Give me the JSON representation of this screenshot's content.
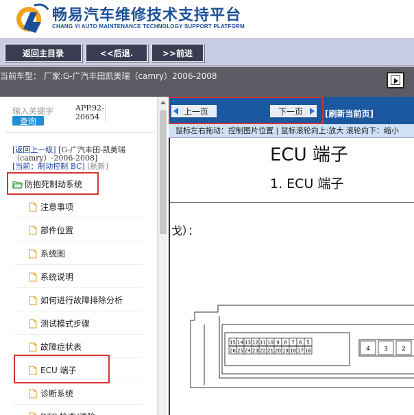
{
  "header": {
    "title": "畅易汽车维修技术支持平台",
    "subtitle": "CHANG YI AUTO MAINTENANCE TECHNOLOGY SUPPORT PLATFORM",
    "brand_color": "#1c4f97"
  },
  "nav": {
    "home_label": "返回主目录",
    "back_label": "<<后退.",
    "forward_label": ">>前进"
  },
  "car_bar": {
    "text": "当前车型：  厂家:G-广汽丰田凯美瑞（camry）2006-2008"
  },
  "left": {
    "search_label": "输入关键字",
    "search_button": "查询",
    "app_version": "APP.92-20654",
    "crumb_back": "[返回上一级]",
    "crumb_model": "[G-广汽丰田-凯美瑞（camry）-2006-2008]",
    "crumb_current": "[当前：制动控制 BC]",
    "crumb_refresh": "[刷新]",
    "tree_root": "防抱死制动系统",
    "tree_items": [
      "注意事项",
      "部件位置",
      "系统图",
      "系统说明",
      "如何进行故障排除分析",
      "测试模式步骤",
      "故障症状表",
      "ECU 端子",
      "诊断系统",
      "DTC 检查/清除"
    ]
  },
  "viewer": {
    "prev_label": "上一页",
    "next_label": "下一页",
    "refresh_label": "[刷新当前页]",
    "hint": "鼠标左右拖动：控制图片位置 | 鼠标滚轮向上:放大  滚轮向下：缩小",
    "doc_title": "ECU 端子",
    "doc_subtitle": "1.   ECU 端子",
    "doc_fragment": "戈）：",
    "connector_top_row": [
      "15",
      "14",
      "13",
      "12",
      "11",
      "10",
      "9",
      "8",
      "7",
      "6",
      "5"
    ],
    "connector_bottom_row": [
      "26",
      "25",
      "24",
      "23",
      "22",
      "21",
      "20",
      "19",
      "18",
      "17",
      "16"
    ],
    "connector_right_pins": [
      "4",
      "3",
      "2"
    ]
  },
  "colors": {
    "highlight_red": "#d63333",
    "toolbar_blue": "#1b58a0",
    "nav_bg": "#c8cde3",
    "car_bar_bg": "#5c5d64"
  }
}
